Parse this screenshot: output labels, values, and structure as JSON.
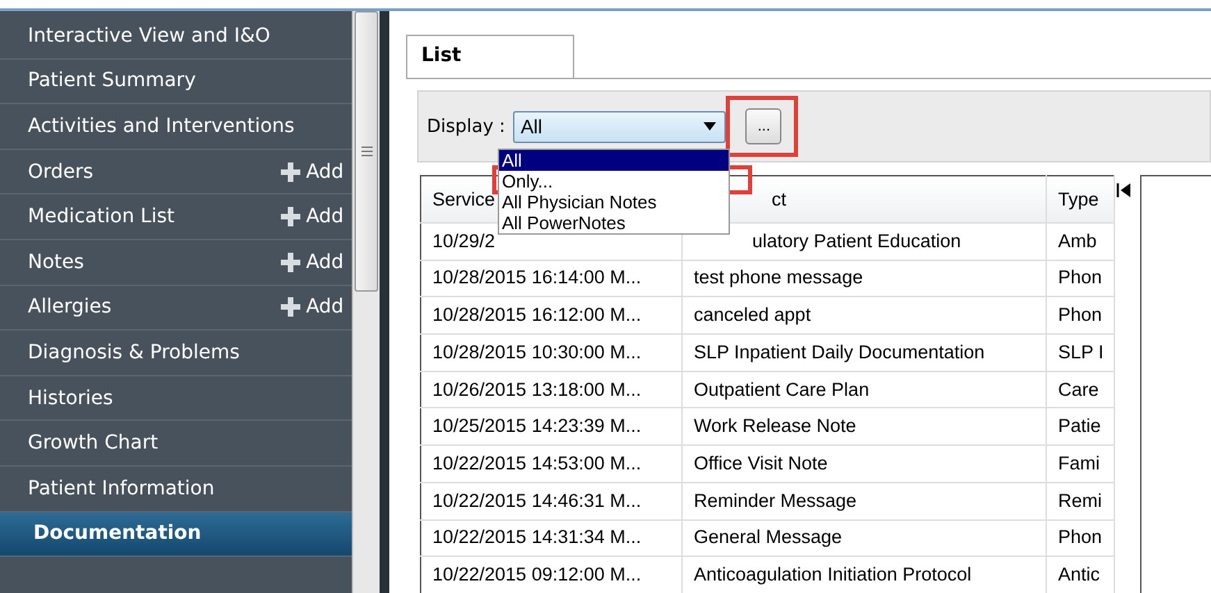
{
  "sidebar": {
    "items": [
      {
        "label": "Interactive View and I&O",
        "selected": false
      },
      {
        "label": "Patient Summary",
        "selected": false
      },
      {
        "label": "Activities and Interventions",
        "selected": false
      },
      {
        "label": "Orders",
        "selected": false,
        "action": "Add"
      },
      {
        "label": "Medication List",
        "selected": false,
        "action": "Add"
      },
      {
        "label": "Notes",
        "selected": false,
        "action": "Add"
      },
      {
        "label": "Allergies",
        "selected": false,
        "action": "Add"
      },
      {
        "label": "Diagnosis & Problems",
        "selected": false
      },
      {
        "label": "Histories",
        "selected": false
      },
      {
        "label": "Growth Chart",
        "selected": false
      },
      {
        "label": "Patient Information",
        "selected": false
      },
      {
        "label": "Documentation",
        "selected": true
      }
    ]
  },
  "tabs": [
    {
      "label": "List",
      "selected": true
    }
  ],
  "display": {
    "label": "Display :",
    "value": "All",
    "button": "...",
    "options": [
      {
        "label": "All",
        "selected": true,
        "highlighted": false
      },
      {
        "label": "Only...",
        "selected": false,
        "highlighted": true
      },
      {
        "label": "All Physician Notes",
        "selected": false,
        "highlighted": false
      },
      {
        "label": "All PowerNotes",
        "selected": false,
        "highlighted": false
      }
    ],
    "button_highlighted": true
  },
  "table": {
    "columns": [
      "Service",
      "ct",
      "Type"
    ],
    "rows": [
      [
        "10/29/2",
        "ulatory Patient Education",
        "Amb"
      ],
      [
        "10/28/2015 16:14:00 M...",
        "test phone message",
        "Phon"
      ],
      [
        "10/28/2015 16:12:00 M...",
        "canceled appt",
        "Phon"
      ],
      [
        "10/28/2015 10:30:00 M...",
        "SLP Inpatient Daily Documentation",
        "SLP I"
      ],
      [
        "10/26/2015 13:18:00 M...",
        "Outpatient Care Plan",
        "Care"
      ],
      [
        "10/25/2015 14:23:39 M...",
        "Work Release Note",
        "Patie"
      ],
      [
        "10/22/2015 14:53:00 M...",
        "Office Visit Note",
        "Fami"
      ],
      [
        "10/22/2015 14:46:31 M...",
        "Reminder Message",
        "Remi"
      ],
      [
        "10/22/2015 14:31:34 M...",
        "General Message",
        "Phon"
      ],
      [
        "10/22/2015 09:12:00 M...",
        "Anticoagulation Initiation Protocol",
        "Antic"
      ]
    ]
  }
}
